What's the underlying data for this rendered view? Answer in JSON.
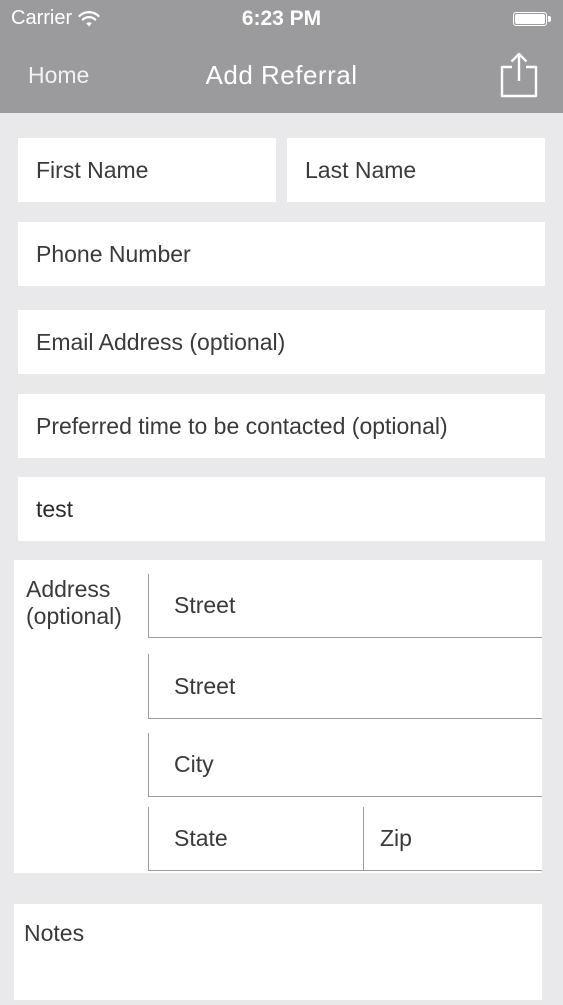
{
  "status_bar": {
    "carrier": "Carrier",
    "time": "6:23 PM"
  },
  "nav": {
    "back_label": "Home",
    "title": "Add Referral",
    "share_icon": "share-icon"
  },
  "form": {
    "first_name": {
      "placeholder": "First Name",
      "value": ""
    },
    "last_name": {
      "placeholder": "Last Name",
      "value": ""
    },
    "phone": {
      "placeholder": "Phone Number",
      "value": ""
    },
    "email": {
      "placeholder": "Email Address (optional)",
      "value": ""
    },
    "preferred_time": {
      "placeholder": "Preferred time to be contacted (optional)",
      "value": ""
    },
    "extra": {
      "placeholder": "",
      "value": "test"
    },
    "address": {
      "label": "Address (optional)",
      "street1": {
        "placeholder": "Street",
        "value": ""
      },
      "street2": {
        "placeholder": "Street",
        "value": ""
      },
      "city": {
        "placeholder": "City",
        "value": ""
      },
      "state": {
        "placeholder": "State",
        "value": ""
      },
      "zip": {
        "placeholder": "Zip",
        "value": ""
      }
    },
    "notes": {
      "placeholder": "Notes",
      "value": ""
    }
  },
  "colors": {
    "nav_bar": "#9b9b9d",
    "background": "#e9e8ea",
    "field_background": "#ffffff",
    "divider": "#9c9c9e"
  }
}
